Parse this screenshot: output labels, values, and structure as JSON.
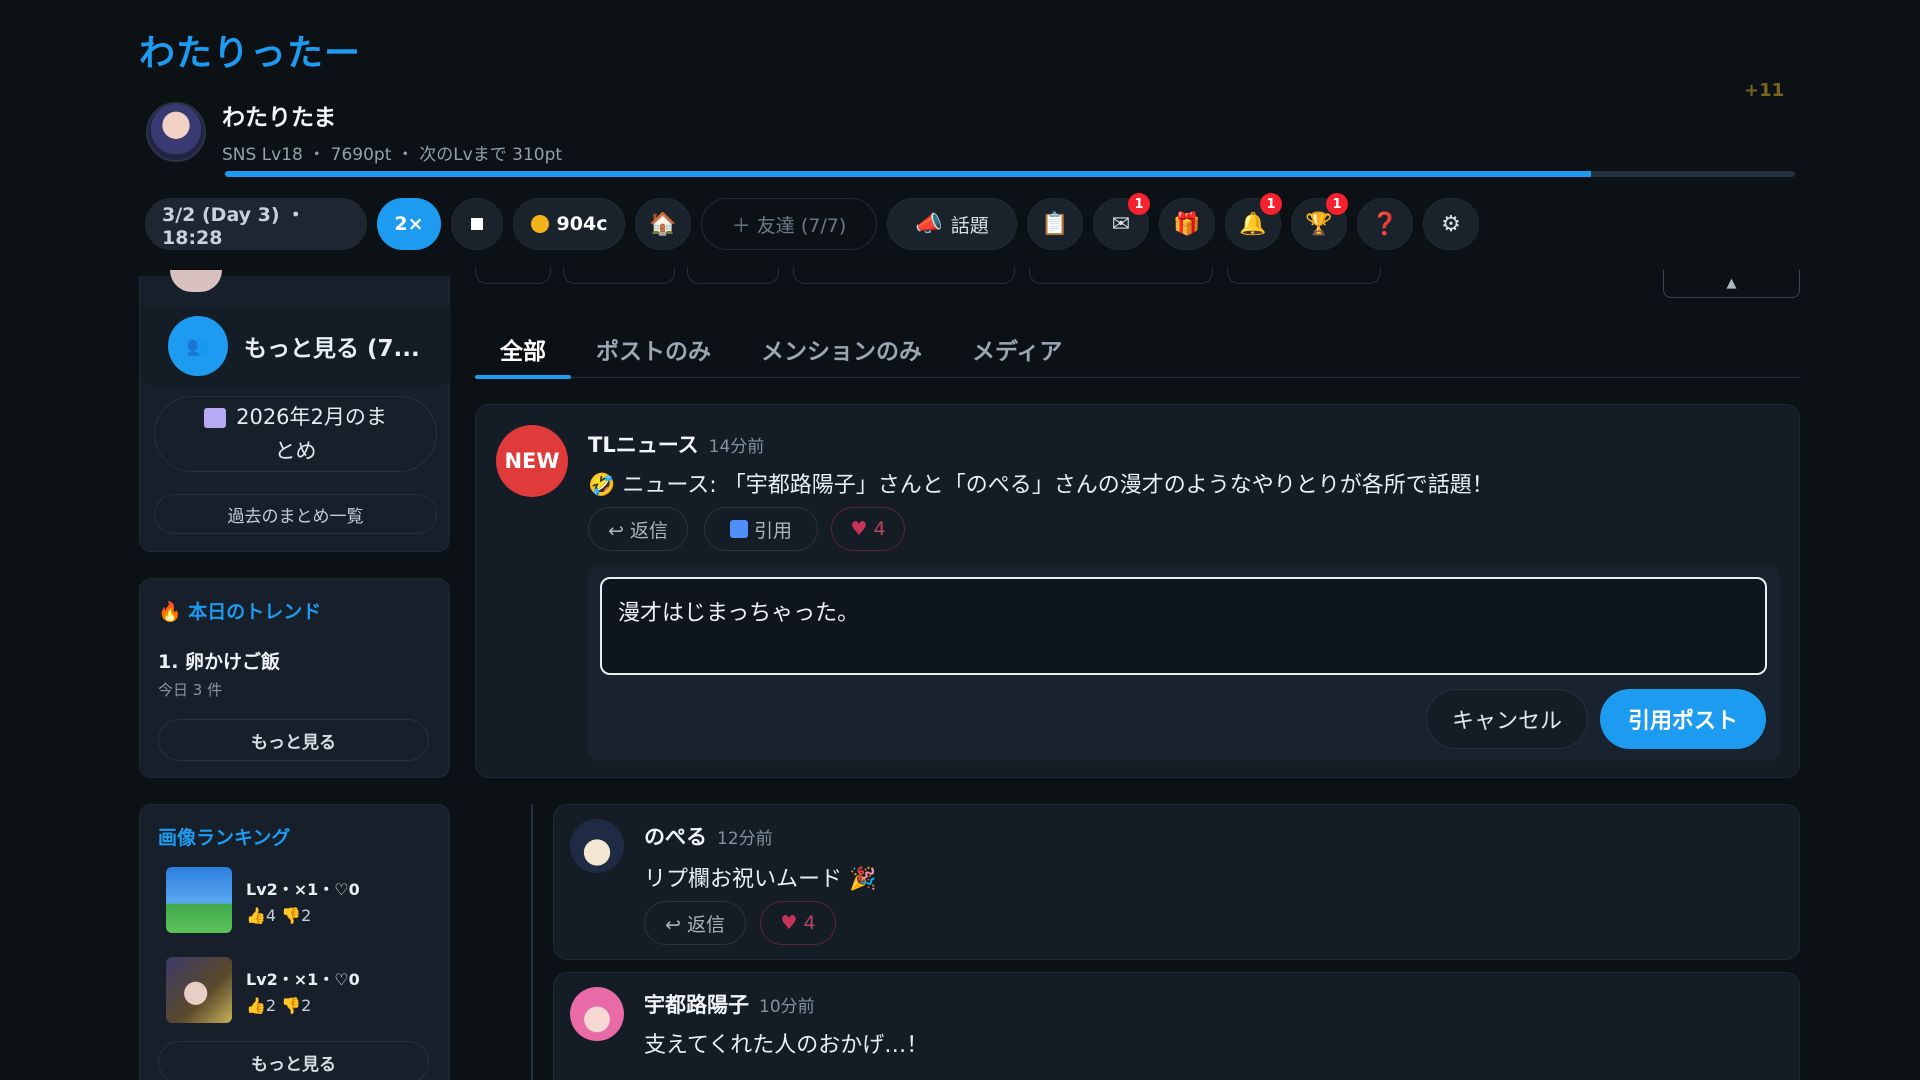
{
  "app_title": "わたりったー",
  "profile": {
    "name": "わたりたま",
    "stats": "SNS Lv18 ・ 7690pt ・ 次のLvまで 310pt",
    "xp_gain": "+11",
    "xp_progress": 0.87
  },
  "toolbar": {
    "date": "3/2 (Day 3) ・ 18:28",
    "speed": "2×",
    "coins": "904c",
    "friends": "＋ 友達 (7/7)",
    "topic": "話題",
    "badges": {
      "mail": "1",
      "notifications": "1",
      "trophy": "1"
    },
    "icons": {
      "home": "🏠",
      "topic": "📣",
      "clipboard": "📋",
      "mail": "✉",
      "gift": "🎁",
      "bell": "🔔",
      "trophy": "🏆",
      "help": "❓",
      "settings": "⚙"
    }
  },
  "sidebar": {
    "more_friends": "もっと見る (7...",
    "monthly_summary": "2026年2月のまとめ",
    "past_summaries": "過去のまとめ一覧",
    "trend": {
      "title": "本日のトレンド",
      "item": "1. 卵かけご飯",
      "count": "今日 3 件",
      "more": "もっと見る"
    },
    "ranking": {
      "title": "画像ランキング",
      "items": [
        {
          "meta": "Lv2・×1・♡0",
          "likes": "4",
          "dislikes": "2"
        },
        {
          "meta": "Lv2・×1・♡0",
          "likes": "2",
          "dislikes": "2"
        }
      ],
      "more": "もっと見る"
    }
  },
  "tabs": [
    "全部",
    "ポストのみ",
    "メンションのみ",
    "メディア"
  ],
  "post": {
    "avatar_label": "NEW",
    "author": "TLニュース",
    "time": "14分前",
    "body": "🤣 ニュース: 「宇都路陽子」さんと「のぺる」さんの漫才のようなやりとりが各所で話題！",
    "reply_label": "↩ 返信",
    "quote_label": "引用",
    "likes": "4"
  },
  "quote_compose": {
    "value": "漫才はじまっちゃった。",
    "cancel": "キャンセル",
    "submit": "引用ポスト"
  },
  "replies": [
    {
      "author": "のぺる",
      "time": "12分前",
      "body": "リプ欄お祝いムード 🎉",
      "reply_label": "↩ 返信",
      "likes": "4"
    },
    {
      "author": "宇都路陽子",
      "time": "10分前",
      "body": "支えてくれた人のおかげ…！"
    }
  ],
  "colors": {
    "accent": "#1d9bf0",
    "background": "#0c1116",
    "badge": "#f4212e",
    "like": "#c8335a"
  }
}
